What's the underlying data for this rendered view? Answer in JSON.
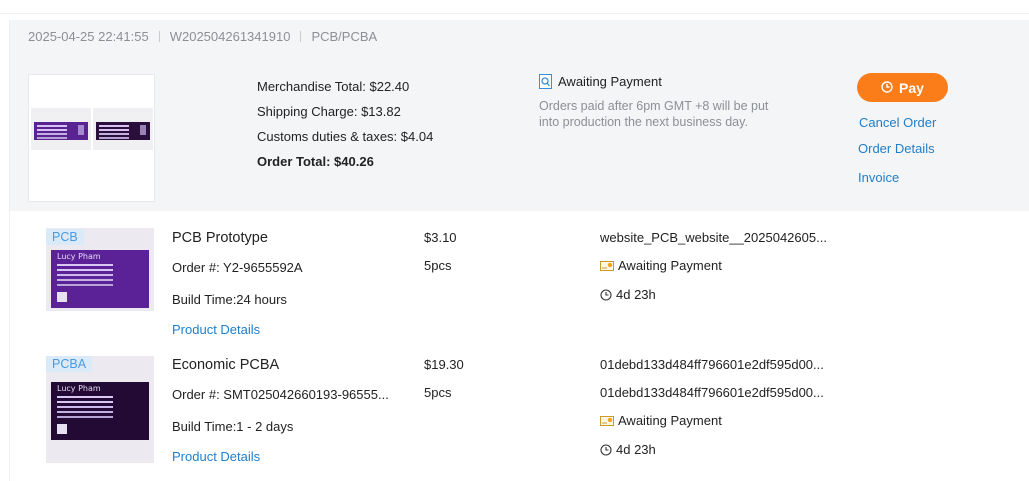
{
  "order": {
    "datetime": "2025-04-25 22:41:55",
    "order_no": "W202504261341910",
    "type": "PCB/PCBA",
    "totals": {
      "merchandise": "Merchandise Total: $22.40",
      "shipping": "Shipping Charge: $13.82",
      "customs": "Customs duties & taxes: $4.04",
      "order_total": "Order Total: $40.26"
    },
    "status": "Awaiting Payment",
    "status_note": "Orders paid after 6pm GMT +8 will be put into production the next business day.",
    "actions": {
      "pay": "Pay",
      "cancel": "Cancel Order",
      "details": "Order Details",
      "invoice": "Invoice"
    },
    "thumb_icon": "pcb-thumbnail-icon",
    "accent_color": "#fa7d1a",
    "link_color": "#1f7ecb"
  },
  "items": [
    {
      "tag": "PCB",
      "name": "PCB Prototype",
      "order_no": "Order #: Y2-9655592A",
      "build_time": "Build Time:24 hours",
      "details_link": "Product Details",
      "price": "$3.10",
      "qty": "5pcs",
      "file": "website_PCB_website__2025042605...",
      "status": "Awaiting Payment",
      "time_left": "4d 23h",
      "board_text": "Lucy Pham"
    },
    {
      "tag": "PCBA",
      "name": "Economic PCBA",
      "order_no": "Order #: SMT025042660193-96555...",
      "build_time": "Build Time:1 - 2 days",
      "details_link": "Product Details",
      "price": "$19.30",
      "qty": "5pcs",
      "file": "01debd133d484ff796601e2df595d00...",
      "file2": "01debd133d484ff796601e2df595d00...",
      "status": "Awaiting Payment",
      "time_left": "4d 23h",
      "board_text": "Lucy Pham"
    }
  ]
}
